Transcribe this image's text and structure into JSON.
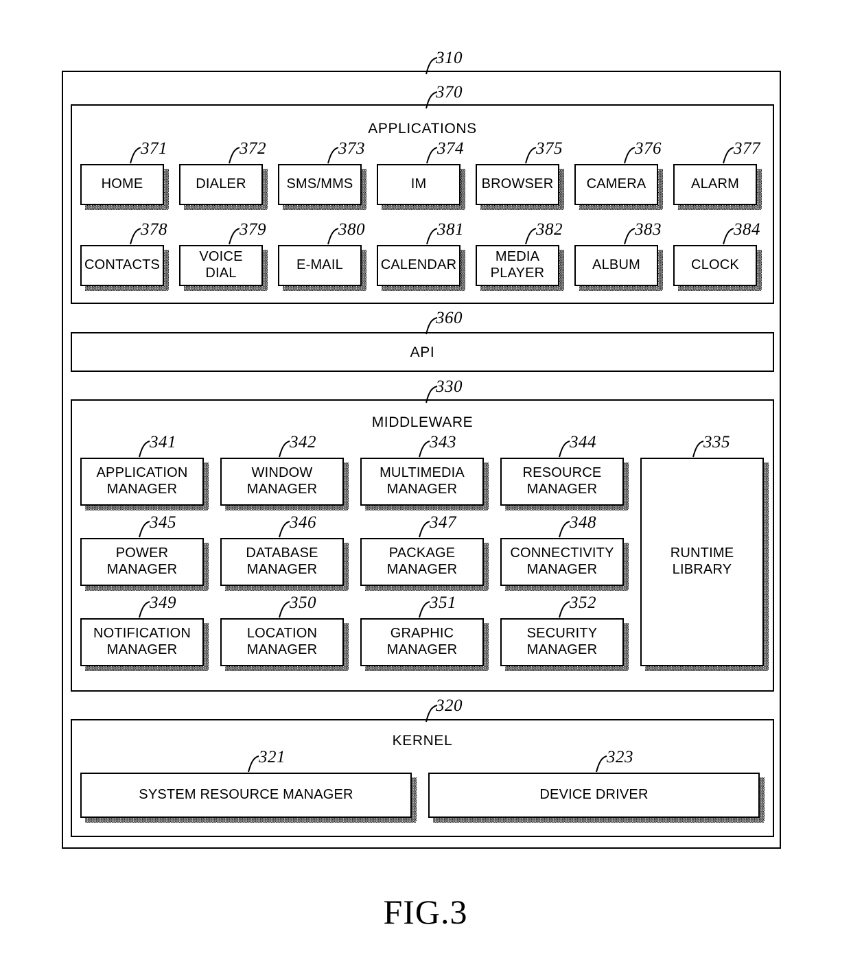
{
  "figure": {
    "caption": "FIG.3",
    "outer_ref": "310"
  },
  "layers": {
    "applications": {
      "ref": "370",
      "title": "APPLICATIONS",
      "items": [
        {
          "ref": "371",
          "label": "HOME"
        },
        {
          "ref": "372",
          "label": "DIALER"
        },
        {
          "ref": "373",
          "label": "SMS/MMS"
        },
        {
          "ref": "374",
          "label": "IM"
        },
        {
          "ref": "375",
          "label": "BROWSER"
        },
        {
          "ref": "376",
          "label": "CAMERA"
        },
        {
          "ref": "377",
          "label": "ALARM"
        },
        {
          "ref": "378",
          "label": "CONTACTS"
        },
        {
          "ref": "379",
          "label": "VOICE\nDIAL"
        },
        {
          "ref": "380",
          "label": "E-MAIL"
        },
        {
          "ref": "381",
          "label": "CALENDAR"
        },
        {
          "ref": "382",
          "label": "MEDIA\nPLAYER"
        },
        {
          "ref": "383",
          "label": "ALBUM"
        },
        {
          "ref": "384",
          "label": "CLOCK"
        }
      ]
    },
    "api": {
      "ref": "360",
      "title": "API"
    },
    "middleware": {
      "ref": "330",
      "title": "MIDDLEWARE",
      "managers": [
        {
          "ref": "341",
          "label": "APPLICATION\nMANAGER"
        },
        {
          "ref": "342",
          "label": "WINDOW\nMANAGER"
        },
        {
          "ref": "343",
          "label": "MULTIMEDIA\nMANAGER"
        },
        {
          "ref": "344",
          "label": "RESOURCE\nMANAGER"
        },
        {
          "ref": "345",
          "label": "POWER\nMANAGER"
        },
        {
          "ref": "346",
          "label": "DATABASE\nMANAGER"
        },
        {
          "ref": "347",
          "label": "PACKAGE\nMANAGER"
        },
        {
          "ref": "348",
          "label": "CONNECTIVITY\nMANAGER"
        },
        {
          "ref": "349",
          "label": "NOTIFICATION\nMANAGER"
        },
        {
          "ref": "350",
          "label": "LOCATION\nMANAGER"
        },
        {
          "ref": "351",
          "label": "GRAPHIC\nMANAGER"
        },
        {
          "ref": "352",
          "label": "SECURITY\nMANAGER"
        }
      ],
      "runtime_library": {
        "ref": "335",
        "label": "RUNTIME\nLIBRARY"
      }
    },
    "kernel": {
      "ref": "320",
      "title": "KERNEL",
      "items": [
        {
          "ref": "321",
          "label": "SYSTEM RESOURCE MANAGER"
        },
        {
          "ref": "323",
          "label": "DEVICE DRIVER"
        }
      ]
    }
  }
}
